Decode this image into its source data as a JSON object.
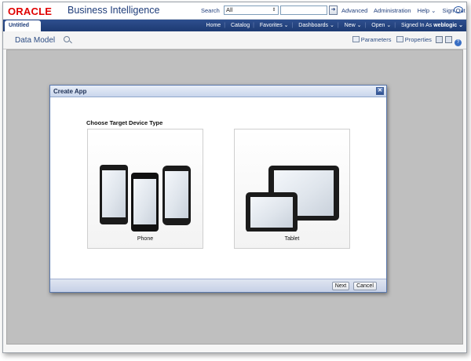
{
  "header": {
    "logo": "ORACLE",
    "product": "Business Intelligence",
    "search_label": "Search",
    "search_scope": "All",
    "links": [
      "Advanced",
      "Administration",
      "Help ⌄",
      "Sign Out"
    ]
  },
  "navbar": {
    "tab": "Untitled",
    "items": [
      "Home",
      "Catalog",
      "Favorites ⌄",
      "Dashboards ⌄",
      "New ⌄",
      "Open ⌄"
    ],
    "signed_in_label": "Signed In As",
    "user": "weblogic ⌄"
  },
  "toolbar": {
    "title": "Data Model",
    "parameters": "Parameters",
    "properties": "Properties",
    "help": "?"
  },
  "dialog": {
    "title": "Create App",
    "prompt": "Choose Target Device Type",
    "options": [
      {
        "label": "Phone",
        "icon": "phone-device-icon"
      },
      {
        "label": "Tablet",
        "icon": "tablet-device-icon"
      }
    ],
    "next": "Next",
    "cancel": "Cancel",
    "close": "✕"
  },
  "colors": {
    "brand_red": "#e00000",
    "nav_blue": "#1d3a72",
    "workspace_grey": "#bfbfbf"
  }
}
